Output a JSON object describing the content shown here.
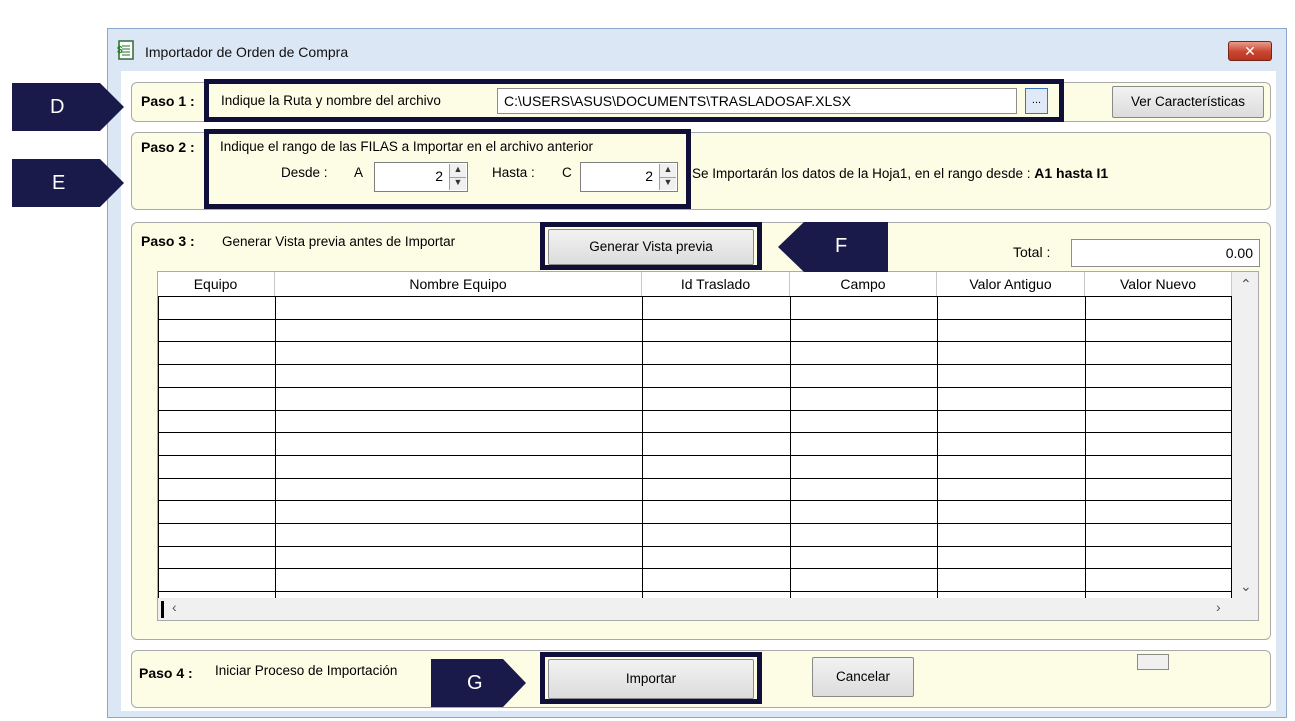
{
  "window": {
    "title": "Importador de Orden de Compra",
    "close_glyph": "✕"
  },
  "step1": {
    "label": "Paso 1 :",
    "prompt": "Indique la Ruta y nombre del archivo",
    "path_value": "C:\\USERS\\ASUS\\DOCUMENTS\\TRASLADOSAF.XLSX",
    "browse_glyph": "...",
    "features_button": "Ver Características"
  },
  "step2": {
    "label": "Paso 2 :",
    "prompt": "Indique el rango de las FILAS a Importar en el archivo anterior",
    "from_label": "Desde :",
    "from_col": "A",
    "from_value": "2",
    "to_label": "Hasta :",
    "to_col": "C",
    "to_value": "2",
    "info_text": "Se Importarán los datos de la Hoja1,  en el rango desde :",
    "info_range": "A1 hasta I1"
  },
  "step3": {
    "label": "Paso 3 :",
    "prompt": "Generar Vista previa antes de Importar",
    "preview_button": "Generar Vista previa",
    "total_label": "Total :",
    "total_value": "0.00",
    "columns": [
      "Equipo",
      "Nombre Equipo",
      "Id Traslado",
      "Campo",
      "Valor Antiguo",
      "Valor Nuevo"
    ]
  },
  "step4": {
    "label": "Paso 4 :",
    "prompt": "Iniciar Proceso de Importación",
    "import_button": "Importar",
    "cancel_button": "Cancelar"
  },
  "callouts": {
    "d": "D",
    "e": "E",
    "f": "F",
    "g": "G"
  },
  "colors": {
    "callout": "#1a1a4a",
    "panel": "#fdfde6",
    "window": "#dbe7f5"
  }
}
